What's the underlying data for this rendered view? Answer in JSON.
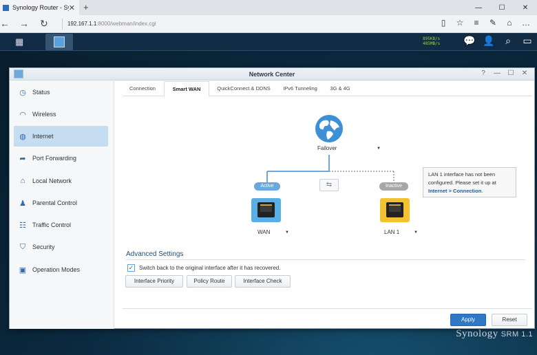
{
  "browser": {
    "tab_title": "Synology Router - Syno",
    "url_host": "192.167.1.1",
    "url_path": ":8000/webman/index.cgi"
  },
  "taskbar": {
    "upload_speed": "895KB/s",
    "download_speed": "485MB/s",
    "brand": "Synology",
    "brand_product": "SRM 1.1"
  },
  "window": {
    "title": "Network Center"
  },
  "sidebar": {
    "items": [
      {
        "label": "Status",
        "icon": "gauge-icon"
      },
      {
        "label": "Wireless",
        "icon": "wifi-icon"
      },
      {
        "label": "Internet",
        "icon": "globe-icon",
        "active": true
      },
      {
        "label": "Port Forwarding",
        "icon": "arrow-forward-icon"
      },
      {
        "label": "Local Network",
        "icon": "home-icon"
      },
      {
        "label": "Parental Control",
        "icon": "family-icon"
      },
      {
        "label": "Traffic Control",
        "icon": "sliders-icon"
      },
      {
        "label": "Security",
        "icon": "shield-icon"
      },
      {
        "label": "Operation Modes",
        "icon": "modes-icon"
      }
    ]
  },
  "tabs": [
    {
      "label": "Connection"
    },
    {
      "label": "Smart WAN",
      "active": true
    },
    {
      "label": "QuickConnect & DDNS"
    },
    {
      "label": "IPv6 Tunneling"
    },
    {
      "label": "3G & 4G"
    }
  ],
  "smart_wan": {
    "mode": "Failover",
    "wan_status": "Active",
    "lan_status": "Inactive",
    "wan_label": "WAN",
    "lan_label": "LAN 1",
    "tooltip_text": "LAN 1 interface has not been configured. Please set it up at",
    "tooltip_link": "Internet > Connection",
    "tooltip_end": "."
  },
  "advanced": {
    "title": "Advanced Settings",
    "switch_back_label": "Switch back to the original interface after it has recovered.",
    "switch_back_checked": true,
    "buttons": [
      "Interface Priority",
      "Policy Route",
      "Interface Check"
    ]
  },
  "footer": {
    "apply_label": "Apply",
    "reset_label": "Reset"
  },
  "colors": {
    "active_wan": "#5aaee8",
    "inactive_lan": "#f2c230",
    "accent": "#2f78c6"
  }
}
